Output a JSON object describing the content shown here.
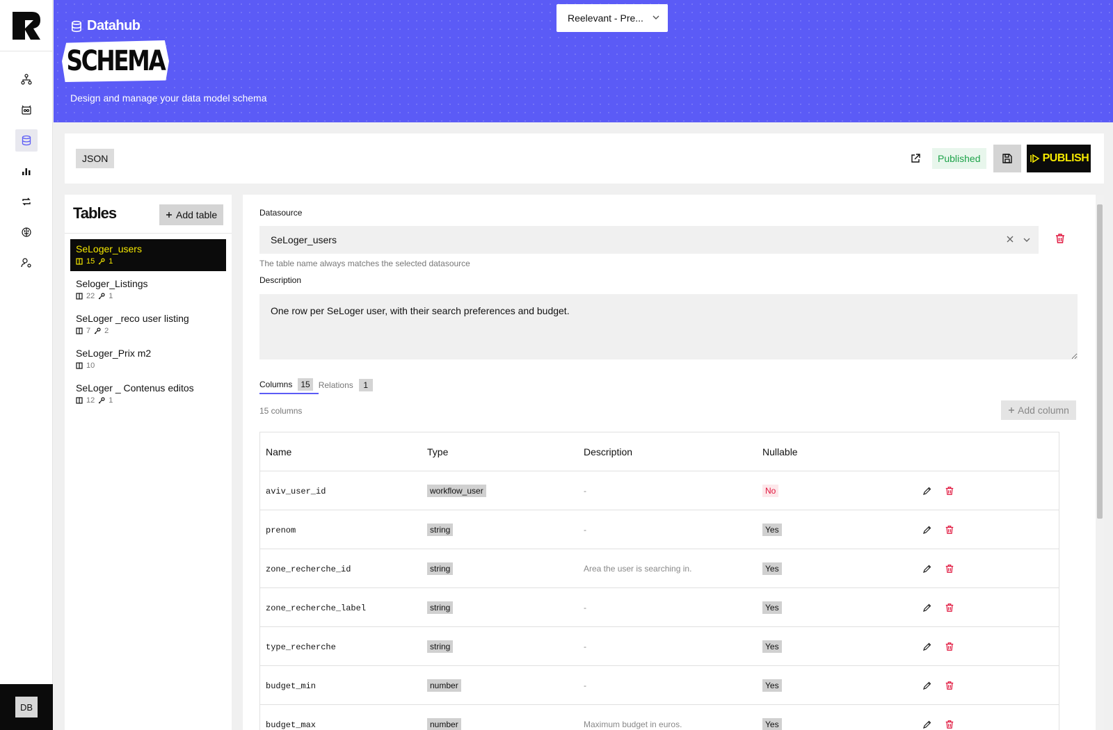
{
  "app": {
    "section": "Datahub",
    "page_badge": "SCHEMA",
    "subtitle": "Design and manage your data model schema",
    "org_selector": "Reelevant - Pre...",
    "avatar_initials": "DB"
  },
  "colors": {
    "header": "#5b5bf6",
    "accent_yellow": "#f5e800",
    "published_green": "#1ea34a",
    "danger": "#e0143c"
  },
  "nav": [
    "network-icon",
    "workflow-icon",
    "database-icon",
    "bar-chart-icon",
    "sync-icon",
    "brain-icon",
    "user-settings-icon"
  ],
  "toolbar": {
    "json_label": "JSON",
    "status": "Published",
    "publish_label": "PUBLISH"
  },
  "tables_panel": {
    "title": "Tables",
    "add_label": "Add table",
    "items": [
      {
        "name": "SeLoger_users",
        "columns": "15",
        "relations": "1"
      },
      {
        "name": "Seloger_Listings",
        "columns": "22",
        "relations": "1"
      },
      {
        "name": "SeLoger _reco user listing",
        "columns": "7",
        "relations": "2"
      },
      {
        "name": "SeLoger_Prix m2",
        "columns": "10",
        "relations": ""
      },
      {
        "name": "SeLoger _ Contenus editos",
        "columns": "12",
        "relations": "1"
      }
    ]
  },
  "editor": {
    "datasource_label": "Datasource",
    "datasource_value": "SeLoger_users",
    "datasource_hint": "The table name always matches the selected datasource",
    "description_label": "Description",
    "description_value": "One row per SeLoger user, with their search preferences and budget.",
    "tabs": [
      {
        "label": "Columns",
        "count": "15"
      },
      {
        "label": "Relations",
        "count": "1"
      }
    ],
    "column_count": "15 columns",
    "add_column_label": "Add column",
    "headers": {
      "name": "Name",
      "type": "Type",
      "description": "Description",
      "nullable": "Nullable"
    },
    "columns": [
      {
        "name": "aviv_user_id",
        "type": "workflow_user",
        "description": "-",
        "nullable": "No"
      },
      {
        "name": "prenom",
        "type": "string",
        "description": "-",
        "nullable": "Yes"
      },
      {
        "name": "zone_recherche_id",
        "type": "string",
        "description": "Area the user is searching in.",
        "nullable": "Yes"
      },
      {
        "name": "zone_recherche_label",
        "type": "string",
        "description": "-",
        "nullable": "Yes"
      },
      {
        "name": "type_recherche",
        "type": "string",
        "description": "-",
        "nullable": "Yes"
      },
      {
        "name": "budget_min",
        "type": "number",
        "description": "-",
        "nullable": "Yes"
      },
      {
        "name": "budget_max",
        "type": "number",
        "description": "Maximum budget in euros.",
        "nullable": "Yes"
      }
    ]
  }
}
